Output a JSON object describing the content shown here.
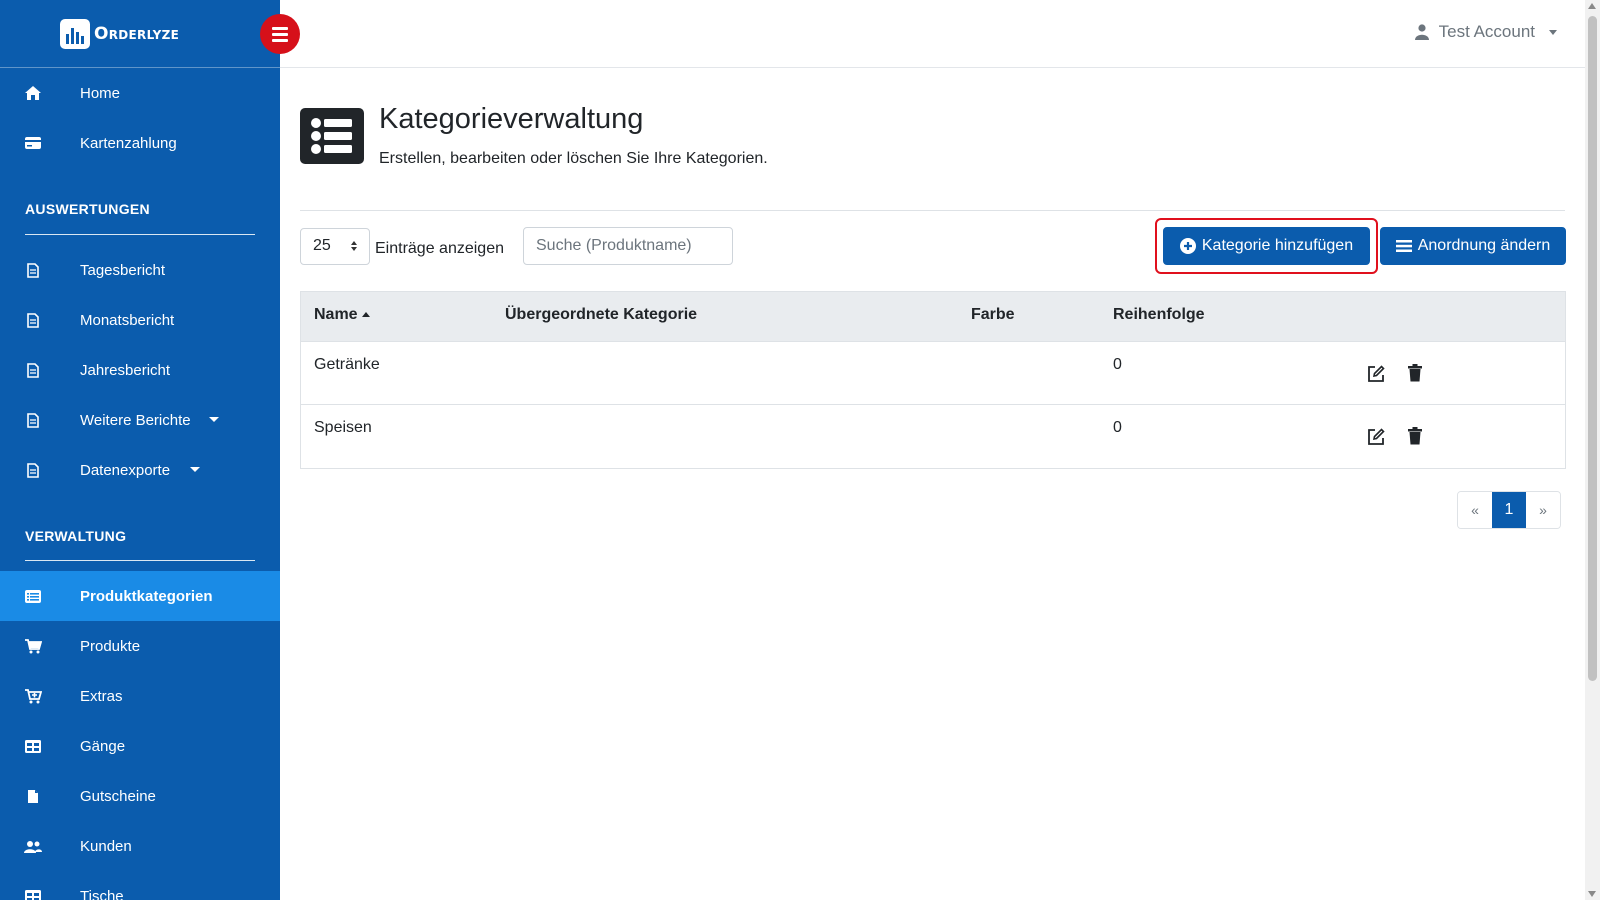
{
  "brand": {
    "name": "Orderlyze"
  },
  "topbar": {
    "account_name": "Test Account"
  },
  "sidebar": {
    "top_items": [
      {
        "label": "Home",
        "icon": "home-icon"
      },
      {
        "label": "Kartenzahlung",
        "icon": "credit-card-icon"
      }
    ],
    "sections": [
      {
        "title": "AUSWERTUNGEN",
        "items": [
          {
            "label": "Tagesbericht",
            "icon": "file-icon"
          },
          {
            "label": "Monatsbericht",
            "icon": "file-icon"
          },
          {
            "label": "Jahresbericht",
            "icon": "file-icon"
          },
          {
            "label": "Weitere Berichte",
            "icon": "file-icon",
            "has_dropdown": true
          },
          {
            "label": "Datenexporte",
            "icon": "file-icon",
            "has_dropdown": true
          }
        ]
      },
      {
        "title": "VERWALTUNG",
        "items": [
          {
            "label": "Produktkategorien",
            "icon": "list-icon",
            "active": true
          },
          {
            "label": "Produkte",
            "icon": "cart-icon"
          },
          {
            "label": "Extras",
            "icon": "cart-plus-icon"
          },
          {
            "label": "Gänge",
            "icon": "table-icon"
          },
          {
            "label": "Gutscheine",
            "icon": "voucher-icon"
          },
          {
            "label": "Kunden",
            "icon": "users-icon"
          },
          {
            "label": "Tische",
            "icon": "table-icon"
          }
        ]
      }
    ]
  },
  "page": {
    "title": "Kategorieverwaltung",
    "subtitle": "Erstellen, bearbeiten oder löschen Sie Ihre Kategorien."
  },
  "controls": {
    "page_length": "25",
    "page_length_label": "Einträge anzeigen",
    "search_placeholder": "Suche (Produktname)",
    "add_button": "Kategorie hinzufügen",
    "reorder_button": "Anordnung ändern"
  },
  "table": {
    "headers": [
      "Name",
      "Übergeordnete Kategorie",
      "Farbe",
      "Reihenfolge"
    ],
    "rows": [
      {
        "name": "Getränke",
        "parent": "",
        "color": "",
        "order": "0"
      },
      {
        "name": "Speisen",
        "parent": "",
        "color": "",
        "order": "0"
      }
    ]
  },
  "pagination": {
    "prev": "«",
    "current": "1",
    "next": "»"
  },
  "colors": {
    "primary": "#0b5cad",
    "sidebar_active": "#1a8be6",
    "highlight": "#e0101d",
    "toggle": "#d6101a"
  }
}
